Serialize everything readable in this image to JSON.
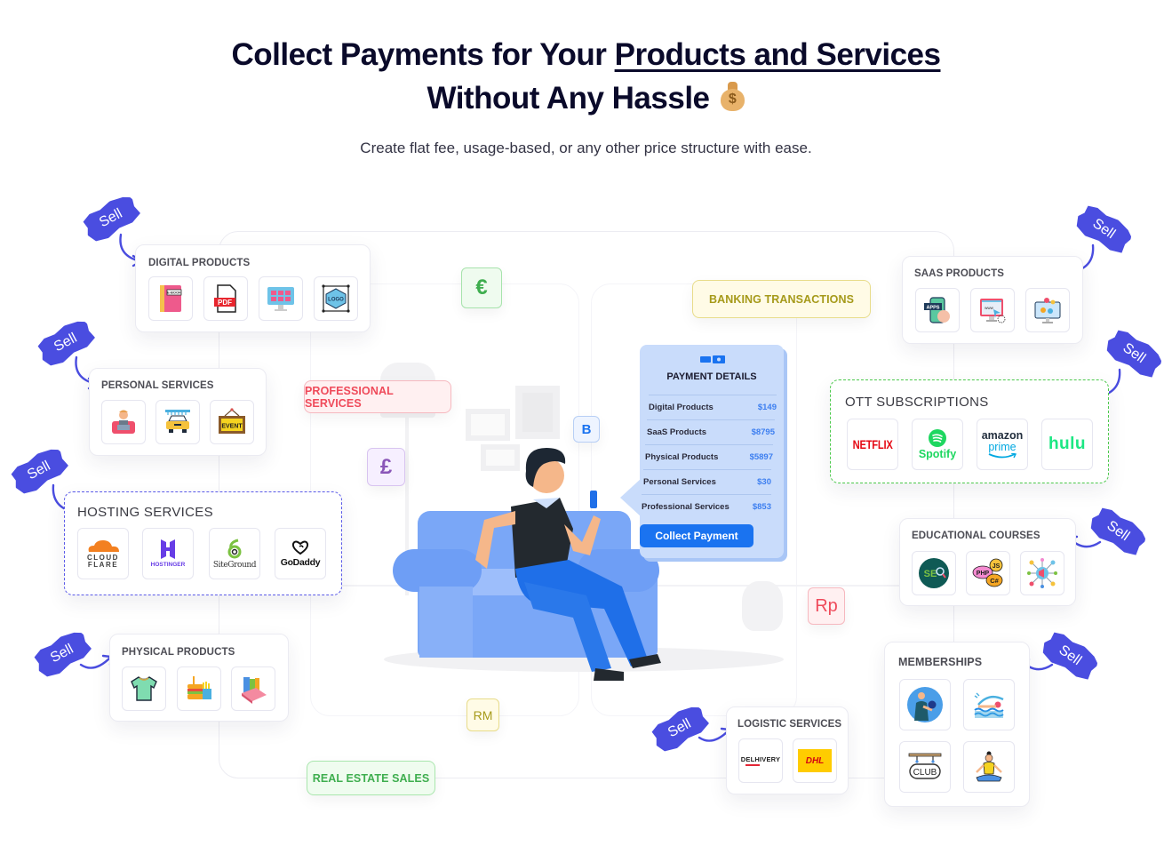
{
  "header": {
    "title_line1_prefix": "Collect Payments for Your ",
    "title_line1_underlined": "Products and Services",
    "title_line2": "Without Any Hassle",
    "title_emoji": "money-bag-icon",
    "dollar_glyph": "$",
    "subtitle": "Create flat fee, usage-based, or any other price structure with ease."
  },
  "sell_label": "Sell",
  "categories": {
    "digital_products": {
      "title": "DIGITAL PRODUCTS",
      "items": [
        {
          "icon": "ebook-icon",
          "label": "E-BOOK"
        },
        {
          "icon": "pdf-icon",
          "label": "PDF"
        },
        {
          "icon": "web-template-icon",
          "label": ""
        },
        {
          "icon": "logo-design-icon",
          "label": "LOGO"
        }
      ]
    },
    "personal_services": {
      "title": "PERSONAL SERVICES",
      "items": [
        {
          "icon": "freelancer-icon",
          "label": ""
        },
        {
          "icon": "car-wash-icon",
          "label": ""
        },
        {
          "icon": "event-sign-icon",
          "label": "EVENT"
        }
      ]
    },
    "hosting_services": {
      "title": "HOSTING SERVICES",
      "items": [
        {
          "icon": "cloudflare-logo",
          "label": "CLOUD FLARE",
          "line1": "CLOUD",
          "line2": "FLARE"
        },
        {
          "icon": "hostinger-logo",
          "label": "HOSTINGER"
        },
        {
          "icon": "siteground-logo",
          "label": "SiteGround"
        },
        {
          "icon": "godaddy-logo",
          "label": "GoDaddy"
        }
      ]
    },
    "physical_products": {
      "title": "PHYSICAL PRODUCTS",
      "items": [
        {
          "icon": "tshirt-icon",
          "label": ""
        },
        {
          "icon": "fast-food-icon",
          "label": ""
        },
        {
          "icon": "books-icon",
          "label": ""
        }
      ]
    },
    "saas_products": {
      "title": "SAAS PRODUCTS",
      "items": [
        {
          "icon": "apps-icon",
          "label": "APPS"
        },
        {
          "icon": "website-icon",
          "label": "www"
        },
        {
          "icon": "desktop-apps-icon",
          "label": ""
        }
      ]
    },
    "ott_subscriptions": {
      "title": "OTT SUBSCRIPTIONS",
      "items": [
        {
          "icon": "netflix-logo",
          "label": "NETFLIX",
          "color": "#e50914"
        },
        {
          "icon": "spotify-logo",
          "label": "Spotify",
          "color": "#1ed760"
        },
        {
          "icon": "amazon-prime-logo",
          "label": "amazon",
          "sub": "prime",
          "color": "#00a8e1"
        },
        {
          "icon": "hulu-logo",
          "label": "hulu",
          "color": "#1ce783"
        }
      ]
    },
    "educational_courses": {
      "title": "EDUCATIONAL COURSES",
      "items": [
        {
          "icon": "seo-icon",
          "label": "SEO"
        },
        {
          "icon": "programming-languages-icon",
          "label": "PHP JS C#",
          "php": "PHP",
          "js": "JS",
          "cs": "C#"
        },
        {
          "icon": "digital-marketing-icon",
          "label": ""
        }
      ]
    },
    "memberships": {
      "title": "MEMBERSHIPS",
      "items": [
        {
          "icon": "gym-icon",
          "label": ""
        },
        {
          "icon": "swimming-icon",
          "label": ""
        },
        {
          "icon": "club-sign-icon",
          "label": "CLUB"
        },
        {
          "icon": "yoga-icon",
          "label": ""
        }
      ]
    },
    "logistic_services": {
      "title": "LOGISTIC SERVICES",
      "items": [
        {
          "icon": "delhivery-logo",
          "label": "DELHIVERY"
        },
        {
          "icon": "dhl-logo",
          "label": "DHL"
        }
      ]
    }
  },
  "tags": {
    "professional_services": "PROFESSIONAL SERVICES",
    "banking_transactions": "BANKING TRANSACTIONS",
    "real_estate_sales": "REAL ESTATE SALES"
  },
  "currencies": {
    "euro": "€",
    "pound": "£",
    "bitcoin": "B",
    "rupiah": "Rp",
    "ringgit": "RM"
  },
  "payment_details": {
    "title": "PAYMENT DETAILS",
    "rows": [
      {
        "label": "Digital Products",
        "amount": "$149"
      },
      {
        "label": "SaaS Products",
        "amount": "$8795"
      },
      {
        "label": "Physical Products",
        "amount": "$5897"
      },
      {
        "label": "Personal Services",
        "amount": "$30"
      },
      {
        "label": "Professional Services",
        "amount": "$853"
      }
    ],
    "button_label": "Collect Payment"
  },
  "colors": {
    "accent_blue": "#4a4de0",
    "primary_button": "#1a73f0",
    "professional_red": "#f0515f",
    "banking_olive": "#a89a1a",
    "real_estate_green": "#3fb34f",
    "euro_green": "#3fae4f",
    "pound_purple": "#8a56b8"
  }
}
